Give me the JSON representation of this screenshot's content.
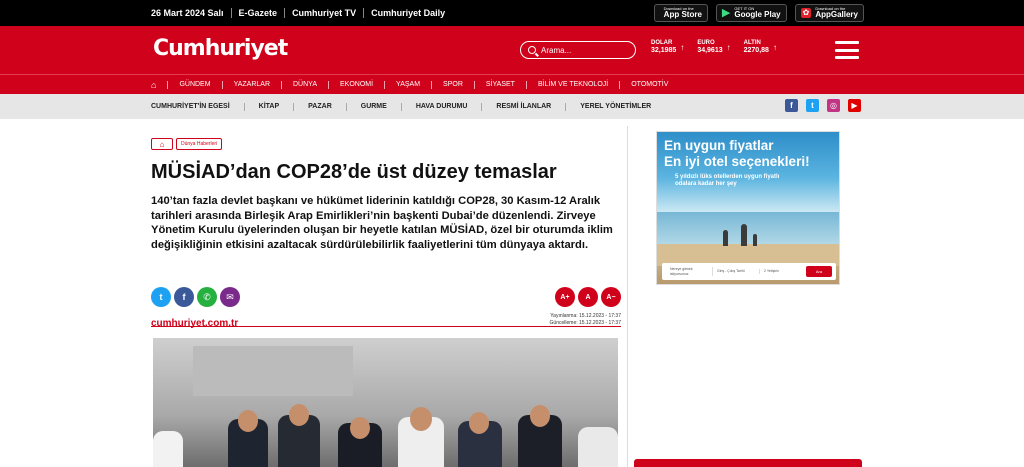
{
  "topbar": {
    "date": "26 Mart 2024 Salı",
    "links": [
      "E-Gazete",
      "Cumhuriyet TV",
      "Cumhuriyet Daily"
    ],
    "stores": [
      {
        "small": "Download on the",
        "big": "App Store",
        "icon": "apple-icon"
      },
      {
        "small": "GET IT ON",
        "big": "Google Play",
        "icon": "google-play-icon"
      },
      {
        "small": "Download on the",
        "big": "AppGallery",
        "icon": "huawei-icon"
      }
    ]
  },
  "header": {
    "logo": "Cumhuriyet",
    "search_placeholder": "Arama...",
    "rates": [
      {
        "name": "DOLAR",
        "value": "32,1985",
        "arrow": "↑"
      },
      {
        "name": "EURO",
        "value": "34,9613",
        "arrow": "↑"
      },
      {
        "name": "ALTIN",
        "value": "2270,88",
        "arrow": "↑"
      }
    ]
  },
  "nav": {
    "home_icon": "⌂",
    "items": [
      "GÜNDEM",
      "YAZARLAR",
      "DÜNYA",
      "EKONOMİ",
      "YAŞAM",
      "SPOR",
      "SİYASET",
      "BİLİM VE TEKNOLOJİ",
      "OTOMOTİV"
    ]
  },
  "subnav": {
    "items": [
      "CUMHURİYET'İN EGESİ",
      "KİTAP",
      "PAZAR",
      "GURME",
      "HAVA DURUMU",
      "RESMİ İLANLAR",
      "YEREL YÖNETİMLER"
    ],
    "social": [
      {
        "icon": "facebook-icon",
        "glyph": "f",
        "color": "#3b5998"
      },
      {
        "icon": "twitter-icon",
        "glyph": "t",
        "color": "#1da1f2"
      },
      {
        "icon": "instagram-icon",
        "glyph": "◎",
        "color": "#c13584"
      },
      {
        "icon": "youtube-icon",
        "glyph": "▶",
        "color": "#e00000"
      }
    ]
  },
  "article": {
    "breadcrumb_home": "⌂",
    "category": "Dünya Haberleri",
    "title": "MÜSİAD’dan COP28’de üst düzey temaslar",
    "lead": "140’tan fazla devlet başkanı ve hükümet liderinin katıldığı COP28, 30 Kasım-12 Aralık tarihleri arasında Birleşik Arap Emirlikleri’nin başkenti Dubai’de düzenlendi. Zirveye Yönetim Kurulu üyelerinden oluşan bir heyetle katılan MÜSİAD, özel bir oturumda iklim değişikliğinin etkisini azaltacak sürdürülebilirlik faaliyetlerini tüm dünyaya aktardı.",
    "share": [
      {
        "icon": "twitter-share-icon",
        "glyph": "t",
        "color": "#1da1f2"
      },
      {
        "icon": "facebook-share-icon",
        "glyph": "f",
        "color": "#3b5998"
      },
      {
        "icon": "whatsapp-share-icon",
        "glyph": "✆",
        "color": "#25b040"
      },
      {
        "icon": "email-share-icon",
        "glyph": "✉",
        "color": "#7a2a8a"
      }
    ],
    "font_buttons": [
      "A+",
      "A",
      "A−"
    ],
    "source": "cumhuriyet.com.tr",
    "published": "Yayınlanma: 15.12.2023 - 17:37",
    "updated": "Güncelleme: 15.12.2023 - 17:37"
  },
  "ad": {
    "headline1": "En uygun fiyatlar",
    "headline2": "En iyi otel seçenekleri!",
    "sub1": "5 yıldızlı lüks otellerden uygun fiyatlı",
    "sub2": "odalara kadar her şey",
    "field_destination": "Nereye gitmek istiyorsunuz",
    "field_dates": "Giriş - Çıkış Tarihi",
    "field_guests": "2 Yetişkin",
    "button": "Ara"
  },
  "colors": {
    "brand_red": "#d0021b",
    "top_black": "#000000",
    "subnav_gray": "#e6e6e6"
  }
}
